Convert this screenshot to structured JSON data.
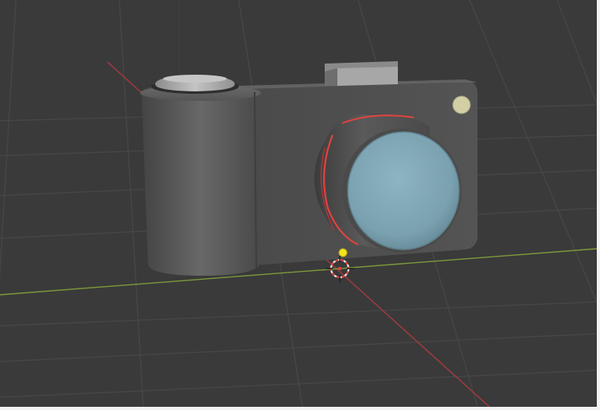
{
  "viewport": {
    "mode": "3d-viewport",
    "background_color": "#3a3a3a",
    "grid_color": "#464646",
    "x_axis_color": "#9a3a3e",
    "y_axis_color": "#7d9a3a",
    "z_axis_color": "#3c3c3c"
  },
  "scene": {
    "objects": [
      {
        "name": "camera-body",
        "icon": "box-mesh",
        "color": "#525252"
      },
      {
        "name": "camera-grip",
        "icon": "cylinder-mesh",
        "color": "#5a5a5a"
      },
      {
        "name": "shutter-button",
        "icon": "cylinder-mesh",
        "color": "#a9a9a9"
      },
      {
        "name": "viewfinder-hump",
        "icon": "box-mesh",
        "color": "#a7a7a7"
      },
      {
        "name": "lens-barrel",
        "icon": "cylinder-mesh",
        "color": "#505050",
        "selected": true,
        "selection_color": "#e0443e"
      },
      {
        "name": "lens-glass",
        "icon": "sphere-mesh",
        "color": "#7fa6b5"
      },
      {
        "name": "flash-dot",
        "icon": "circle-mesh",
        "color": "#d3cfa5"
      }
    ],
    "origin_marker_color": "#f4e51c",
    "cursor_3d": "3d-cursor"
  }
}
